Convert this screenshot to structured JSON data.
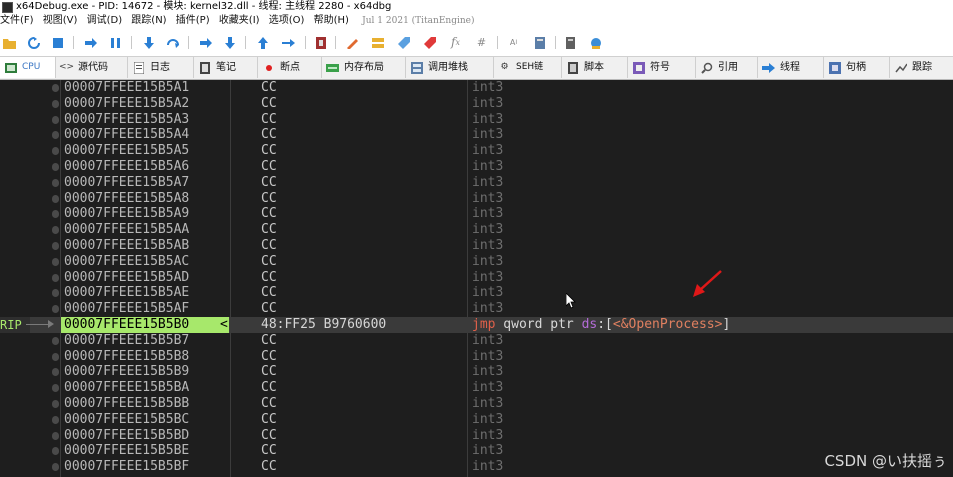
{
  "window": {
    "title": "x64Debug.exe - PID: 14672 - 模块: kernel32.dll - 线程: 主线程 2280 - x64dbg"
  },
  "menu": {
    "items": [
      "文件(F)",
      "视图(V)",
      "调试(D)",
      "跟踪(N)",
      "插件(P)",
      "收藏夹(I)",
      "选项(O)",
      "帮助(H)"
    ],
    "build_date": "Jul 1 2021 (TitanEngine)"
  },
  "tabs": [
    {
      "label": "CPU",
      "icon": "cpu-icon",
      "active": true
    },
    {
      "label": "源代码",
      "icon": "code-icon"
    },
    {
      "label": "日志",
      "icon": "log-icon"
    },
    {
      "label": "笔记",
      "icon": "notes-icon"
    },
    {
      "label": "断点",
      "icon": "breakpoint-icon"
    },
    {
      "label": "内存布局",
      "icon": "memory-map-icon"
    },
    {
      "label": "调用堆栈",
      "icon": "call-stack-icon"
    },
    {
      "label": "SEH链",
      "icon": "seh-chain-icon"
    },
    {
      "label": "脚本",
      "icon": "script-icon"
    },
    {
      "label": "符号",
      "icon": "symbols-icon"
    },
    {
      "label": "引用",
      "icon": "references-icon"
    },
    {
      "label": "线程",
      "icon": "threads-icon"
    },
    {
      "label": "句柄",
      "icon": "handles-icon"
    },
    {
      "label": "跟踪",
      "icon": "trace-icon"
    }
  ],
  "disasm": {
    "rip_label": "RIP",
    "selected_marker": "<",
    "rows": [
      {
        "addr": "00007FFEEE15B5A1",
        "bytes": "CC",
        "ins": "int3"
      },
      {
        "addr": "00007FFEEE15B5A2",
        "bytes": "CC",
        "ins": "int3"
      },
      {
        "addr": "00007FFEEE15B5A3",
        "bytes": "CC",
        "ins": "int3"
      },
      {
        "addr": "00007FFEEE15B5A4",
        "bytes": "CC",
        "ins": "int3"
      },
      {
        "addr": "00007FFEEE15B5A5",
        "bytes": "CC",
        "ins": "int3"
      },
      {
        "addr": "00007FFEEE15B5A6",
        "bytes": "CC",
        "ins": "int3"
      },
      {
        "addr": "00007FFEEE15B5A7",
        "bytes": "CC",
        "ins": "int3"
      },
      {
        "addr": "00007FFEEE15B5A8",
        "bytes": "CC",
        "ins": "int3"
      },
      {
        "addr": "00007FFEEE15B5A9",
        "bytes": "CC",
        "ins": "int3"
      },
      {
        "addr": "00007FFEEE15B5AA",
        "bytes": "CC",
        "ins": "int3"
      },
      {
        "addr": "00007FFEEE15B5AB",
        "bytes": "CC",
        "ins": "int3"
      },
      {
        "addr": "00007FFEEE15B5AC",
        "bytes": "CC",
        "ins": "int3"
      },
      {
        "addr": "00007FFEEE15B5AD",
        "bytes": "CC",
        "ins": "int3"
      },
      {
        "addr": "00007FFEEE15B5AE",
        "bytes": "CC",
        "ins": "int3"
      },
      {
        "addr": "00007FFEEE15B5AF",
        "bytes": "CC",
        "ins": "int3"
      },
      {
        "addr": "00007FFEEE15B5B0",
        "bytes": "48:FF25 B9760600",
        "mnemonic": "jmp",
        "ins_mid": " qword ptr ",
        "segment": "ds",
        "ins_open": ":[",
        "label": "<&OpenProcess>",
        "ins_close": "]",
        "selected": true
      },
      {
        "addr": "00007FFEEE15B5B7",
        "bytes": "CC",
        "ins": "int3"
      },
      {
        "addr": "00007FFEEE15B5B8",
        "bytes": "CC",
        "ins": "int3"
      },
      {
        "addr": "00007FFEEE15B5B9",
        "bytes": "CC",
        "ins": "int3"
      },
      {
        "addr": "00007FFEEE15B5BA",
        "bytes": "CC",
        "ins": "int3"
      },
      {
        "addr": "00007FFEEE15B5BB",
        "bytes": "CC",
        "ins": "int3"
      },
      {
        "addr": "00007FFEEE15B5BC",
        "bytes": "CC",
        "ins": "int3"
      },
      {
        "addr": "00007FFEEE15B5BD",
        "bytes": "CC",
        "ins": "int3"
      },
      {
        "addr": "00007FFEEE15B5BE",
        "bytes": "CC",
        "ins": "int3"
      },
      {
        "addr": "00007FFEEE15B5BF",
        "bytes": "CC",
        "ins": "int3"
      }
    ]
  },
  "watermark": "CSDN @い扶摇ぅ",
  "colors": {
    "selected_address_bg": "#a7e86b",
    "mnemonic_jmp": "#e0604a",
    "segment": "#b56cd8",
    "symbol_label": "#e08060",
    "annotation_arrow": "#e01818"
  }
}
